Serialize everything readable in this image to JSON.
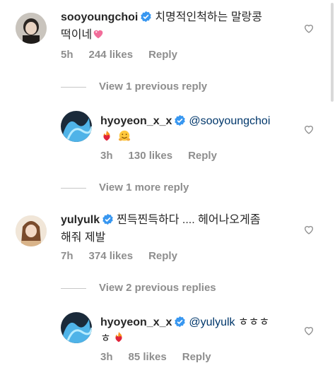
{
  "comments": [
    {
      "username": "sooyoungchoi",
      "text_line1": "치명적인척하는 말랑콩",
      "text_line2": "떡이네",
      "time": "5h",
      "likes": "244 likes",
      "reply": "Reply"
    },
    {
      "username": "hyoyeon_x_x",
      "mention": "@sooyoungchoi",
      "time": "3h",
      "likes": "130 likes",
      "reply": "Reply"
    },
    {
      "username": "yulyulk",
      "text_line1": "찐득찐득하다 .... 헤어나오게좀",
      "text_line2": "해줘 제발",
      "time": "7h",
      "likes": "374 likes",
      "reply": "Reply"
    },
    {
      "username": "hyoyeon_x_x",
      "mention": "@yulyulk",
      "text_line1": "ㅎㅎㅎ",
      "text_line2": "ㅎ",
      "time": "3h",
      "likes": "85 likes",
      "reply": "Reply"
    }
  ],
  "view_links": {
    "previous_1": "View 1 previous reply",
    "more_1": "View 1 more reply",
    "previous_2": "View 2 previous replies"
  },
  "colors": {
    "verified": "#3897f0",
    "muted": "#8e8e8e",
    "mention": "#00376b"
  }
}
